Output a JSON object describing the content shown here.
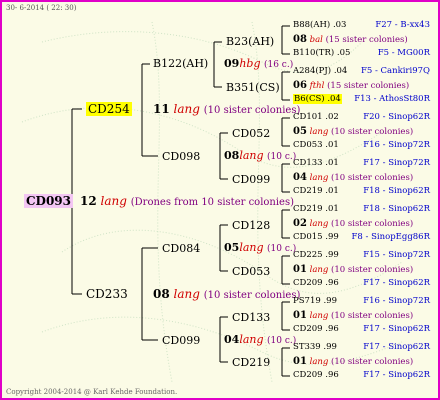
{
  "header": {
    "date_line": "30-  6-2014 ( 22: 30)"
  },
  "footer": {
    "copyright": "Copyright 2004-2014 @ Karl Kehde Foundation."
  },
  "colors": {
    "border": "#e000c8",
    "background": "#fbfbe6",
    "lang": "#d00000",
    "sister": "#800080",
    "ref": "#0000cc",
    "root_highlight": "#f3c6f3",
    "yellow_highlight": "#ffff00"
  },
  "root": {
    "id": "CD093",
    "gen": "12",
    "lang": "lang",
    "note": "(Drones from 10 sister colonies)"
  },
  "level1": [
    {
      "id": "CD254",
      "gen": "11",
      "lang": "lang",
      "note": "(10 sister colonies)"
    },
    {
      "id": "CD233",
      "gen": "08",
      "lang": "lang",
      "note": "(10 sister colonies)"
    }
  ],
  "level2": [
    {
      "id": "B122(AH)",
      "gen": "09",
      "lang": "hbg",
      "note": "(16 c.)"
    },
    {
      "id": "CD098",
      "gen": "08",
      "lang": "lang",
      "note": "(10 c.)"
    },
    {
      "id": "CD084",
      "gen": "05",
      "lang": "lang",
      "note": "(10 c.)"
    },
    {
      "id": "CD099",
      "gen": "04",
      "lang": "lang",
      "note": "(10 c.)"
    }
  ],
  "level3": [
    "B23(AH)",
    "B351(CS)",
    "CD052",
    "CD099",
    "CD128",
    "CD053",
    "CD133",
    "CD219"
  ],
  "level4": [
    {
      "father": "B88(AH) .03",
      "ref": "F27 - B-xx43",
      "gen": "08",
      "lang": "bal",
      "note": "(15 sister colonies)",
      "mother": "B110(TR) .05",
      "mref": "F5 - MG00R"
    },
    {
      "father": "A284(PJ) .04",
      "ref": "F5 - Cankiri97Q",
      "gen": "06",
      "lang": "fthl",
      "note": "(15 sister colonies)",
      "mother": "B6(CS) .04",
      "mref": "F13 - AthosSt80R"
    },
    {
      "father": "CD101 .02",
      "ref": "F20 - Sinop62R",
      "gen": "05",
      "lang": "lang",
      "note": "(10 sister colonies)",
      "mother": "CD053 .01",
      "mref": "F16 - Sinop72R"
    },
    {
      "father": "CD133 .01",
      "ref": "F17 - Sinop72R",
      "gen": "04",
      "lang": "lang",
      "note": "(10 sister colonies)",
      "mother": "CD219 .01",
      "mref": "F18 - Sinop62R"
    },
    {
      "father": "CD219 .01",
      "ref": "F18 - Sinop62R",
      "gen": "02",
      "lang": "lang",
      "note": "(10 sister colonies)",
      "mother": "CD015 .99",
      "mref": "F8 - SinopEgg86R"
    },
    {
      "father": "CD225 .99",
      "ref": "F15 - Sinop72R",
      "gen": "01",
      "lang": "lang",
      "note": "(10 sister colonies)",
      "mother": "CD209 .96",
      "mref": "F17 - Sinop62R"
    },
    {
      "father": "PS719 .99",
      "ref": "F16 - Sinop72R",
      "gen": "01",
      "lang": "lang",
      "note": "(10 sister colonies)",
      "mother": "CD209 .96",
      "mref": "F17 - Sinop62R"
    },
    {
      "father": "ST339 .99",
      "ref": "F17 - Sinop62R",
      "gen": "01",
      "lang": "lang",
      "note": "(10 sister colonies)",
      "mother": "CD209 .96",
      "mref": "F17 - Sinop62R"
    }
  ]
}
